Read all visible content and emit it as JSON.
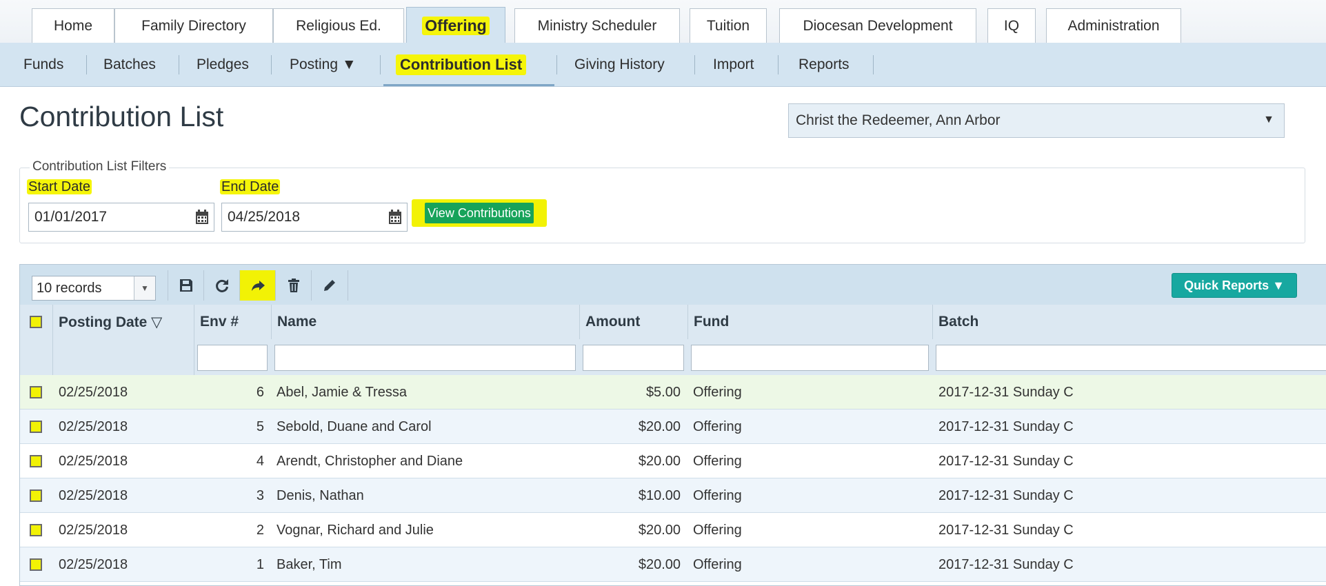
{
  "top_tabs": [
    {
      "label": "Home"
    },
    {
      "label": "Family Directory"
    },
    {
      "label": "Religious Ed."
    },
    {
      "label": "Offering"
    },
    {
      "label": "Ministry Scheduler"
    },
    {
      "label": "Tuition"
    },
    {
      "label": "Diocesan Development"
    },
    {
      "label": "IQ"
    },
    {
      "label": "Administration"
    }
  ],
  "active_top_tab": "Offering",
  "sub_nav": [
    {
      "label": "Funds"
    },
    {
      "label": "Batches"
    },
    {
      "label": "Pledges"
    },
    {
      "label": "Posting ▼"
    },
    {
      "label": "Contribution List"
    },
    {
      "label": "Giving History"
    },
    {
      "label": "Import"
    },
    {
      "label": "Reports"
    }
  ],
  "active_sub_nav": "Contribution List",
  "page": {
    "title": "Contribution List",
    "parish_select": "Christ the Redeemer, Ann Arbor"
  },
  "filters": {
    "legend": "Contribution List Filters",
    "start_label": "Start Date",
    "start_value": "01/01/2017",
    "end_label": "End Date",
    "end_value": "04/25/2018",
    "view_button": "View Contributions"
  },
  "grid": {
    "records_select": "10 records",
    "quick_reports": "Quick Reports ▼",
    "columns": [
      {
        "label": "Posting Date ▽"
      },
      {
        "label": "Env #"
      },
      {
        "label": "Name"
      },
      {
        "label": "Amount"
      },
      {
        "label": "Fund"
      },
      {
        "label": "Batch"
      }
    ],
    "rows": [
      {
        "date": "02/25/2018",
        "env": "6",
        "name": "Abel, Jamie & Tressa",
        "amount": "$5.00",
        "fund": "Offering",
        "batch": "2017-12-31 Sunday C"
      },
      {
        "date": "02/25/2018",
        "env": "5",
        "name": "Sebold, Duane and Carol",
        "amount": "$20.00",
        "fund": "Offering",
        "batch": "2017-12-31 Sunday C"
      },
      {
        "date": "02/25/2018",
        "env": "4",
        "name": "Arendt, Christopher and Diane",
        "amount": "$20.00",
        "fund": "Offering",
        "batch": "2017-12-31 Sunday C"
      },
      {
        "date": "02/25/2018",
        "env": "3",
        "name": "Denis, Nathan",
        "amount": "$10.00",
        "fund": "Offering",
        "batch": "2017-12-31 Sunday C"
      },
      {
        "date": "02/25/2018",
        "env": "2",
        "name": "Vognar, Richard and Julie",
        "amount": "$20.00",
        "fund": "Offering",
        "batch": "2017-12-31 Sunday C"
      },
      {
        "date": "02/25/2018",
        "env": "1",
        "name": "Baker, Tim",
        "amount": "$20.00",
        "fund": "Offering",
        "batch": "2017-12-31 Sunday C"
      }
    ]
  },
  "icons": {
    "save": "save-icon",
    "refresh": "refresh-icon",
    "forward": "forward-arrow-icon",
    "delete": "trash-icon",
    "edit": "pencil-icon",
    "calendar": "calendar-icon"
  },
  "colors": {
    "highlight": "#f2f205",
    "accent_green": "#17a35a",
    "quick_reports": "#17a8a0",
    "nav_bg": "#d3e4f1"
  }
}
